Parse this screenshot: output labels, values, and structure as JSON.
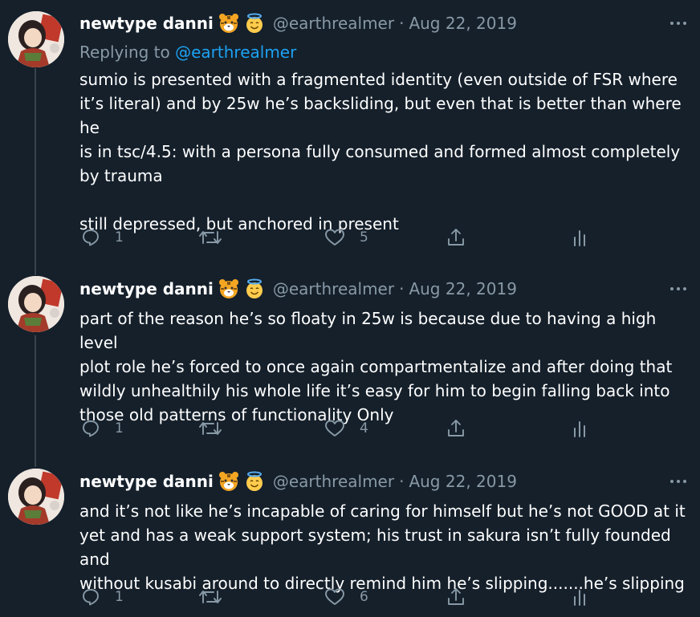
{
  "tweets": [
    {
      "display_name": "newtype danni",
      "handle": "@earthrealmer",
      "separator": "·",
      "date": "Aug 22, 2019",
      "replying_prefix": "Replying to",
      "replying_to": "@earthrealmer",
      "text": "sumio is presented with a fragmented identity (even outside of FSR where\nit’s literal) and by 25w he’s backsliding, but even that is better than where he\nis in tsc/4.5: with a persona fully consumed and formed almost completely\nby trauma\n\nstill depressed, but anchored in present",
      "replies": "1",
      "likes": "5"
    },
    {
      "display_name": "newtype danni",
      "handle": "@earthrealmer",
      "separator": "·",
      "date": "Aug 22, 2019",
      "text": "part of the reason he’s so floaty in 25w is because due to having a high level\nplot role he’s forced to once again compartmentalize and after doing that\nwildly unhealthily his whole life it’s easy for him to begin falling back into\nthose old patterns of functionality Only",
      "replies": "1",
      "likes": "4"
    },
    {
      "display_name": "newtype danni",
      "handle": "@earthrealmer",
      "separator": "·",
      "date": "Aug 22, 2019",
      "text": "and it’s not like he’s incapable of caring for himself but he’s not GOOD at it\nyet and has a weak support system; his trust in sakura isn’t fully founded and\nwithout kusabi around to directly remind him he’s slipping.......he’s slipping",
      "replies": "1",
      "likes": "6"
    }
  ],
  "icons": {
    "name_emojis": [
      "tiger-face-emoji",
      "smiling-face-with-halo-emoji"
    ],
    "actions": [
      "reply-icon",
      "retweet-icon",
      "like-icon",
      "share-icon",
      "analytics-icon"
    ]
  },
  "colors": {
    "background": "#15202b",
    "text": "#ffffff",
    "secondary": "#8899a6",
    "link": "#1da1f2",
    "thread_line": "#38444d"
  }
}
